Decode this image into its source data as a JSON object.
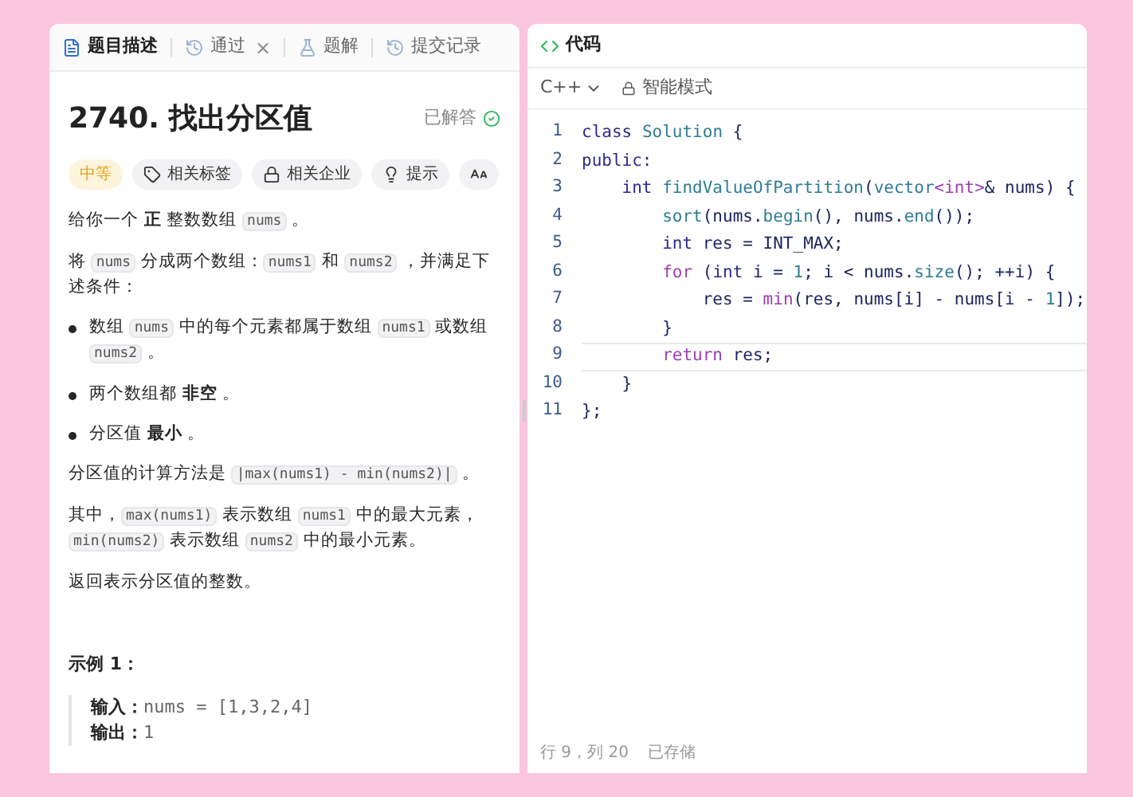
{
  "left_tabs": [
    {
      "label": "题目描述",
      "selected": true
    },
    {
      "label": "通过",
      "selected": false,
      "close": "×"
    },
    {
      "label": "题解",
      "selected": false
    },
    {
      "label": "提交记录",
      "selected": false
    }
  ],
  "problem": {
    "title": "2740. 找出分区值",
    "status": "已解答",
    "solved": true,
    "tags": [
      {
        "kind": "difficulty",
        "label": "中等"
      },
      {
        "kind": "tags",
        "label": "相关标签"
      },
      {
        "kind": "companies",
        "label": "相关企业"
      },
      {
        "kind": "hint",
        "label": "提示"
      },
      {
        "kind": "font"
      }
    ],
    "blocks": [
      {
        "kind": "para",
        "segments": [
          {
            "kind": "text",
            "text": "给你一个 "
          },
          {
            "kind": "bold",
            "text": "正"
          },
          {
            "kind": "text",
            "text": " 整数数组 "
          },
          {
            "kind": "code",
            "text": "nums"
          },
          {
            "kind": "text",
            "text": " 。"
          }
        ]
      },
      {
        "kind": "para",
        "segments": [
          {
            "kind": "text",
            "text": "将 "
          },
          {
            "kind": "code",
            "text": "nums"
          },
          {
            "kind": "text",
            "text": " 分成两个数组："
          },
          {
            "kind": "code",
            "text": "nums1"
          },
          {
            "kind": "text",
            "text": " 和 "
          },
          {
            "kind": "code",
            "text": "nums2"
          },
          {
            "kind": "text",
            "text": " ，并满足下述条件："
          }
        ]
      },
      {
        "kind": "bullet",
        "segments": [
          {
            "kind": "text",
            "text": "数组 "
          },
          {
            "kind": "code",
            "text": "nums"
          },
          {
            "kind": "text",
            "text": " 中的每个元素都属于数组 "
          },
          {
            "kind": "code",
            "text": "nums1"
          },
          {
            "kind": "text",
            "text": " 或数组 "
          },
          {
            "kind": "code",
            "text": "nums2"
          },
          {
            "kind": "text",
            "text": " 。"
          }
        ]
      },
      {
        "kind": "bullet",
        "segments": [
          {
            "kind": "text",
            "text": "两个数组都 "
          },
          {
            "kind": "bold",
            "text": "非空"
          },
          {
            "kind": "text",
            "text": " 。"
          }
        ]
      },
      {
        "kind": "bullet",
        "segments": [
          {
            "kind": "text",
            "text": "分区值 "
          },
          {
            "kind": "bold",
            "text": "最小"
          },
          {
            "kind": "text",
            "text": " 。"
          }
        ]
      },
      {
        "kind": "para",
        "segments": [
          {
            "kind": "text",
            "text": "分区值的计算方法是 "
          },
          {
            "kind": "code",
            "text": "|max(nums1) - min(nums2)|"
          },
          {
            "kind": "text",
            "text": " 。"
          }
        ]
      },
      {
        "kind": "para",
        "segments": [
          {
            "kind": "text",
            "text": "其中，"
          },
          {
            "kind": "code",
            "text": "max(nums1)"
          },
          {
            "kind": "text",
            "text": " 表示数组 "
          },
          {
            "kind": "code",
            "text": "nums1"
          },
          {
            "kind": "text",
            "text": " 中的最大元素，"
          },
          {
            "kind": "code",
            "text": "min(nums2)"
          },
          {
            "kind": "text",
            "text": " 表示数组 "
          },
          {
            "kind": "code",
            "text": "nums2"
          },
          {
            "kind": "text",
            "text": " 中的最小元素。"
          }
        ]
      },
      {
        "kind": "para",
        "segments": [
          {
            "kind": "text",
            "text": "返回表示分区值的整数。"
          }
        ]
      }
    ],
    "example": {
      "title": "示例 1：",
      "lines": [
        {
          "label": "输入：",
          "value": "nums = [1,3,2,4]"
        },
        {
          "label": "输出：",
          "value": "1"
        }
      ]
    }
  },
  "editor": {
    "title": "代码",
    "language": "C++",
    "mode": "智能模式",
    "lines": [
      {
        "no": "1",
        "tokens": [
          {
            "kind": "kw",
            "text": "class "
          },
          {
            "kind": "fn",
            "text": "Solution"
          },
          {
            "kind": "plain",
            "text": " {"
          }
        ]
      },
      {
        "no": "2",
        "tokens": [
          {
            "kind": "kw",
            "text": "public:"
          }
        ]
      },
      {
        "no": "3",
        "tokens": [
          {
            "kind": "kw",
            "text": "    int "
          },
          {
            "kind": "fn",
            "text": "findValueOfPartition"
          },
          {
            "kind": "plain",
            "text": "("
          },
          {
            "kind": "fn",
            "text": "vector"
          },
          {
            "kind": "ctl",
            "text": "<int>"
          },
          {
            "kind": "plain",
            "text": "& nums) {"
          }
        ]
      },
      {
        "no": "4",
        "tokens": [
          {
            "kind": "fn",
            "text": "        sort"
          },
          {
            "kind": "plain",
            "text": "(nums."
          },
          {
            "kind": "fn",
            "text": "begin"
          },
          {
            "kind": "plain",
            "text": "(), nums."
          },
          {
            "kind": "fn",
            "text": "end"
          },
          {
            "kind": "plain",
            "text": "());"
          }
        ]
      },
      {
        "no": "5",
        "tokens": [
          {
            "kind": "kw",
            "text": "        int "
          },
          {
            "kind": "plain",
            "text": "res = INT_MAX;"
          }
        ]
      },
      {
        "no": "6",
        "tokens": [
          {
            "kind": "ctl",
            "text": "        for "
          },
          {
            "kind": "plain",
            "text": "("
          },
          {
            "kind": "kw",
            "text": "int "
          },
          {
            "kind": "plain",
            "text": "i = "
          },
          {
            "kind": "fn",
            "text": "1"
          },
          {
            "kind": "plain",
            "text": "; i < nums."
          },
          {
            "kind": "fn",
            "text": "size"
          },
          {
            "kind": "plain",
            "text": "(); ++i) {"
          }
        ]
      },
      {
        "no": "7",
        "tokens": [
          {
            "kind": "plain",
            "text": "            res = "
          },
          {
            "kind": "ctl",
            "text": "min"
          },
          {
            "kind": "plain",
            "text": "(res, nums[i] - nums[i - "
          },
          {
            "kind": "fn",
            "text": "1"
          },
          {
            "kind": "plain",
            "text": "]);"
          }
        ]
      },
      {
        "no": "8",
        "tokens": [
          {
            "kind": "plain",
            "text": "        }"
          }
        ]
      },
      {
        "no": "9",
        "current": true,
        "tokens": [
          {
            "kind": "ctl",
            "text": "        return "
          },
          {
            "kind": "plain",
            "text": "res;"
          }
        ]
      },
      {
        "no": "10",
        "tokens": [
          {
            "kind": "plain",
            "text": "    }"
          }
        ]
      },
      {
        "no": "11",
        "tokens": [
          {
            "kind": "plain",
            "text": "};"
          }
        ]
      }
    ],
    "status": [
      {
        "text": "行 9，列 20"
      },
      {
        "text": "已存储"
      }
    ]
  }
}
